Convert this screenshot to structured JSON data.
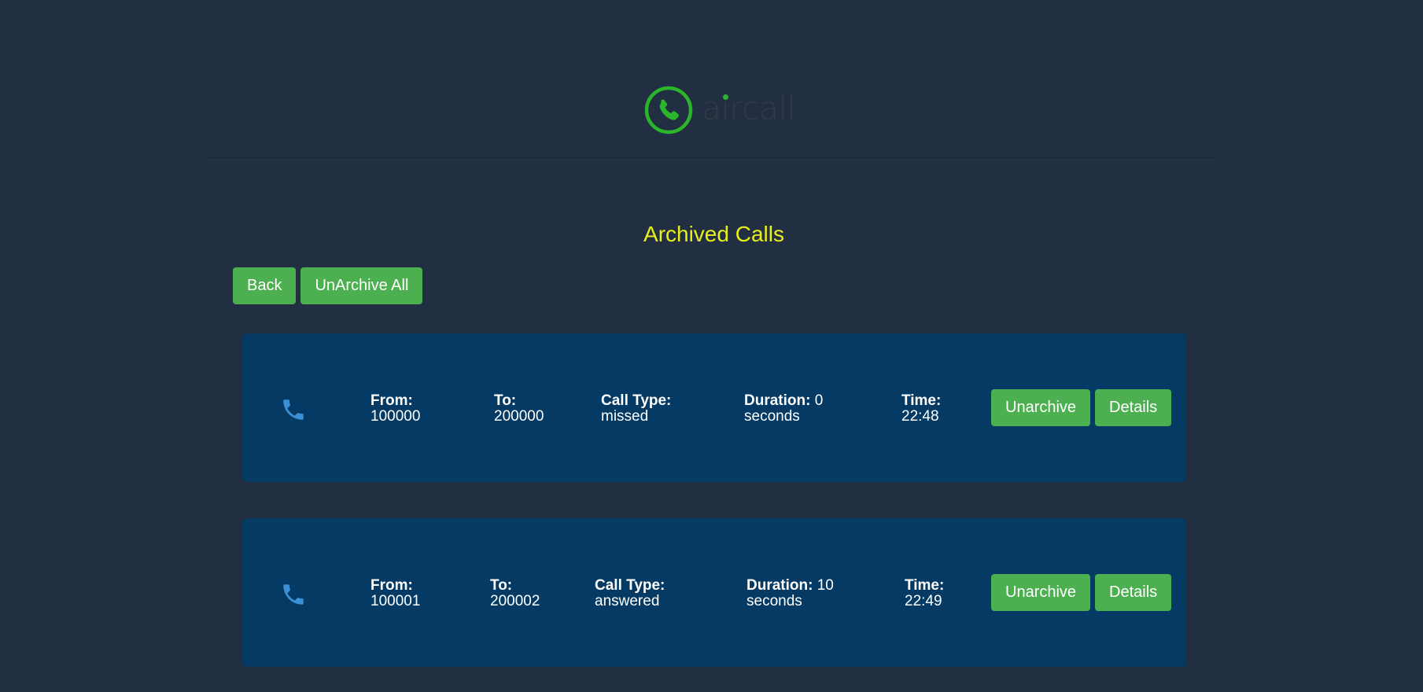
{
  "header": {
    "logo_text": "aircall",
    "logo_icon": "phone-circle-icon",
    "brand_color": "#2ab52a"
  },
  "page_title": "Archived Calls",
  "toolbar": {
    "back_label": "Back",
    "unarchive_all_label": "UnArchive All"
  },
  "labels": {
    "from": "From:",
    "to": "To:",
    "call_type": "Call Type:",
    "duration": "Duration:",
    "time": "Time:",
    "unarchive": "Unarchive",
    "details": "Details"
  },
  "calls": [
    {
      "from": "100000",
      "to": "200000",
      "call_type": "missed",
      "duration_value": "0",
      "duration_unit": "seconds",
      "time": "22:48",
      "icon": "phone-icon"
    },
    {
      "from": "100001",
      "to": "200002",
      "call_type": "answered",
      "duration_value": "10",
      "duration_unit": "seconds",
      "time": "22:49",
      "icon": "phone-icon"
    }
  ],
  "colors": {
    "background": "#222f42",
    "card": "#043a63",
    "button": "#4caf50",
    "title": "#e8ee1a",
    "icon": "#3a8fd6"
  }
}
